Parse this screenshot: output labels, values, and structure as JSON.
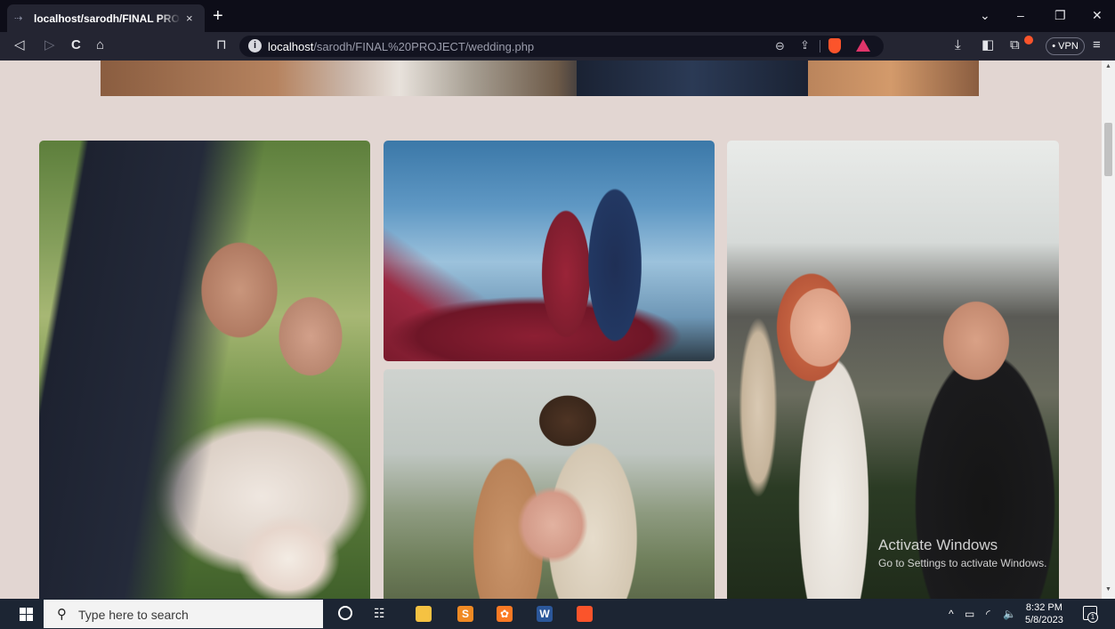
{
  "browser": {
    "tab_title": "localhost/sarodh/FINAL PROJECT",
    "tab_close": "×",
    "new_tab": "+",
    "url_host": "localhost",
    "url_path": "/sarodh/FINAL%20PROJECT/wedding.php",
    "vpn_label": "• VPN",
    "window_controls": {
      "dropdown": "⌄",
      "minimize": "–",
      "restore": "❐",
      "close": "✕"
    },
    "nav": {
      "back": "◁",
      "forward": "▷",
      "reload": "C",
      "home": "⌂",
      "bookmark": "⊓",
      "downloads": "⤓",
      "sidebar": "◧",
      "wallet": "⧉",
      "menu": "≡"
    },
    "url_actions": {
      "zoom": "⊖",
      "share": "⇪"
    },
    "info_icon": "i"
  },
  "page": {
    "gallery": [
      {
        "alt": "Groom in black tuxedo embracing bride holding bouquet"
      },
      {
        "alt": "Couple with red flowing dress against blue sky"
      },
      {
        "alt": "Couple touching foreheads holding bouquet"
      },
      {
        "alt": "Couple showing wedding rings celebrating"
      }
    ],
    "banner_alt": "Wedding banner"
  },
  "watermark": {
    "title": "Activate Windows",
    "subtitle": "Go to Settings to activate Windows."
  },
  "taskbar": {
    "search_placeholder": "Type here to search",
    "search_icon": "⚲",
    "taskview_icon": "☷",
    "time": "8:32 PM",
    "date": "5/8/2023",
    "notification_count": "1",
    "tray": {
      "chevron": "^",
      "battery": "▭",
      "wifi": "◜",
      "volume": "🔈"
    },
    "apps": [
      {
        "name": "file-explorer",
        "label": "",
        "color": "#f5c242"
      },
      {
        "name": "sublime-text",
        "label": "S",
        "color": "#f08a24"
      },
      {
        "name": "xampp",
        "label": "✿",
        "color": "#fb7a24"
      },
      {
        "name": "word",
        "label": "W",
        "color": "#2b579a"
      },
      {
        "name": "brave",
        "label": "",
        "color": "#fb542b"
      }
    ]
  }
}
